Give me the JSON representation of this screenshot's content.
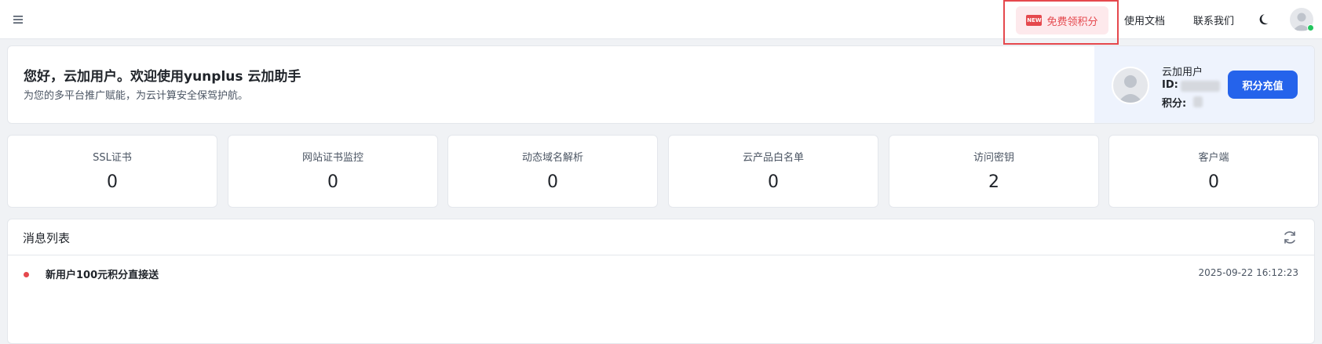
{
  "topbar": {
    "menu_icon": "hamburger-menu-icon",
    "promo": {
      "badge": "NEW",
      "label": "免费领积分",
      "accent": "#e5484d"
    },
    "links": [
      "使用文档",
      "联系我们"
    ],
    "theme_icon": "moon-icon",
    "avatar_icon": "user-avatar-icon"
  },
  "welcome": {
    "title": "您好，云加用户。欢迎使用yunplus 云加助手",
    "subtitle": "为您的多平台推广赋能，为云计算安全保驾护航。"
  },
  "user": {
    "name": "云加用户",
    "id_label": "ID:",
    "points_label": "积分:",
    "recharge_label": "积分充值",
    "accent": "#2563eb"
  },
  "stats": [
    {
      "label": "SSL证书",
      "value": "0"
    },
    {
      "label": "网站证书监控",
      "value": "0"
    },
    {
      "label": "动态域名解析",
      "value": "0"
    },
    {
      "label": "云产品白名单",
      "value": "0"
    },
    {
      "label": "访问密钥",
      "value": "2"
    },
    {
      "label": "客户端",
      "value": "0"
    }
  ],
  "messages": {
    "title": "消息列表",
    "refresh_icon": "refresh-icon",
    "items": [
      {
        "text": "新用户100元积分直接送",
        "time": "2025-09-22 16:12:23"
      }
    ]
  }
}
